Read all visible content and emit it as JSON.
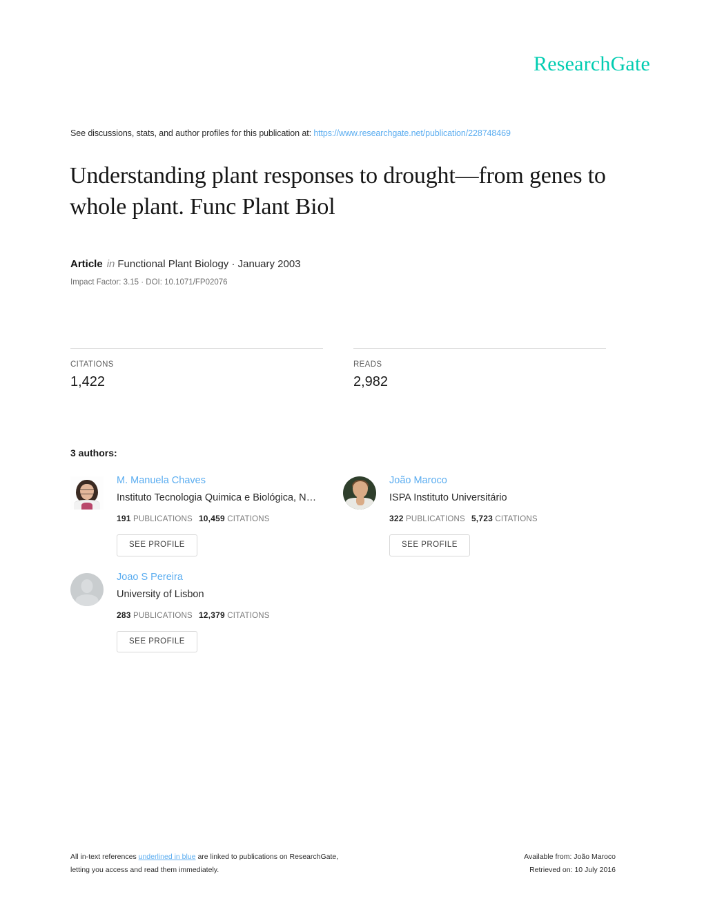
{
  "brand": {
    "name": "ResearchGate",
    "color": "#00ccb1"
  },
  "discussion": {
    "prefix": "See discussions, stats, and author profiles for this publication at:",
    "url": "https://www.researchgate.net/publication/228748469",
    "link_color": "#5badf0"
  },
  "publication": {
    "title": "Understanding plant responses to drought—from genes to whole plant. Func Plant Biol",
    "kind": "Article",
    "connector": "in",
    "journal": "Functional Plant Biology · January 2003",
    "impact_line": "Impact Factor: 3.15 · DOI: 10.1071/FP02076"
  },
  "stats": [
    {
      "label": "CITATIONS",
      "value": "1,422"
    },
    {
      "label": "READS",
      "value": "2,982"
    }
  ],
  "authors_section": {
    "heading": "3 authors:",
    "see_profile_label": "SEE PROFILE",
    "authors": [
      {
        "name": "M. Manuela Chaves",
        "affiliation": "Instituto Tecnologia Quimica e Biológica, N…",
        "publications": "191",
        "publications_label": "PUBLICATIONS",
        "citations": "10,459",
        "citations_label": "CITATIONS",
        "avatar": "photo-avatar-chaves"
      },
      {
        "name": "João Maroco",
        "affiliation": "ISPA Instituto Universitário",
        "publications": "322",
        "publications_label": "PUBLICATIONS",
        "citations": "5,723",
        "citations_label": "CITATIONS",
        "avatar": "photo-avatar-maroco"
      },
      {
        "name": "Joao S Pereira",
        "affiliation": "University of Lisbon",
        "publications": "283",
        "publications_label": "PUBLICATIONS",
        "citations": "12,379",
        "citations_label": "CITATIONS",
        "avatar": "placeholder-avatar-icon"
      }
    ]
  },
  "footer": {
    "left_part1": "All in-text references ",
    "left_link": "underlined in blue",
    "left_part2": " are linked to publications on ResearchGate,",
    "left_line2": "letting you access and read them immediately.",
    "right_line1": "Available from: João Maroco",
    "right_line2": "Retrieved on: 10 July 2016"
  }
}
